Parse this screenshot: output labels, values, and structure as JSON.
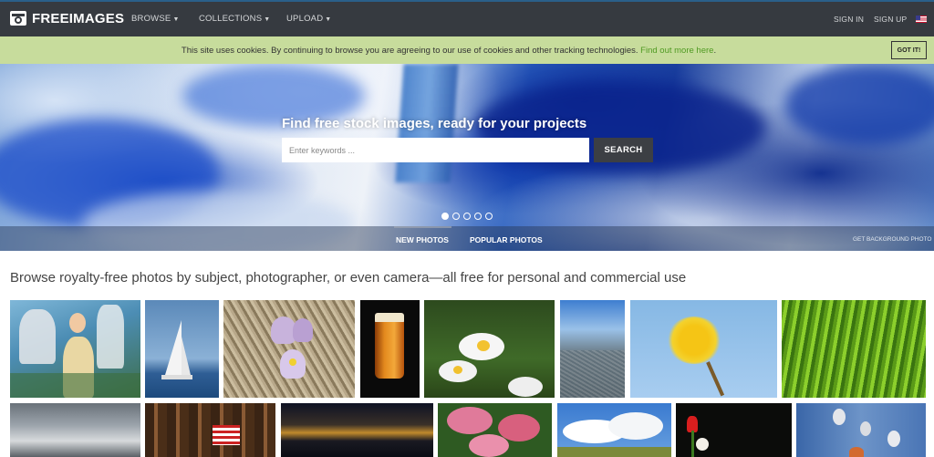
{
  "brand": {
    "name": "FREEIMAGES"
  },
  "nav": {
    "items": [
      {
        "label": "BROWSE",
        "has_caret": true
      },
      {
        "label": "COLLECTIONS",
        "has_caret": true
      },
      {
        "label": "UPLOAD",
        "has_caret": true
      }
    ],
    "sign_in": "SIGN IN",
    "sign_up": "SIGN UP",
    "language_icon": "us-flag-icon"
  },
  "cookie_banner": {
    "text": "This site uses cookies. By continuing to browse you are agreeing to our use of cookies and other tracking technologies.",
    "link": "Find out more here",
    "suffix": ".",
    "button": "GOT IT!"
  },
  "hero": {
    "title": "Find free stock images, ready for your projects",
    "search_placeholder": "Enter keywords ...",
    "search_button": "SEARCH",
    "slides_total": 5,
    "slide_active": 1,
    "tabs": [
      {
        "label": "NEW PHOTOS",
        "active": true
      },
      {
        "label": "POPULAR PHOTOS",
        "active": false
      }
    ],
    "get_background": "GET BACKGROUND PHOTO"
  },
  "main": {
    "headline": "Browse royalty-free photos by subject, photographer, or even camera—all free for personal and commercial use"
  },
  "photos": [
    {
      "subject": "girl-in-costume-mural"
    },
    {
      "subject": "sailboat"
    },
    {
      "subject": "crocus-flower"
    },
    {
      "subject": "beer-glass"
    },
    {
      "subject": "daisies"
    },
    {
      "subject": "aerial-city"
    },
    {
      "subject": "dandelion"
    },
    {
      "subject": "green-grass-blur"
    },
    {
      "subject": "stormy-sky"
    },
    {
      "subject": "building-with-flag"
    },
    {
      "subject": "sunset-over-sea"
    },
    {
      "subject": "pink-flowers"
    },
    {
      "subject": "clouds-blue-sky"
    },
    {
      "subject": "tulips"
    },
    {
      "subject": "willow-catkins"
    }
  ],
  "colors": {
    "nav_bg": "#363a40",
    "cookie_bg": "#c7dc9c",
    "cookie_link": "#4f9a22",
    "search_button_bg": "#3c3f44"
  }
}
